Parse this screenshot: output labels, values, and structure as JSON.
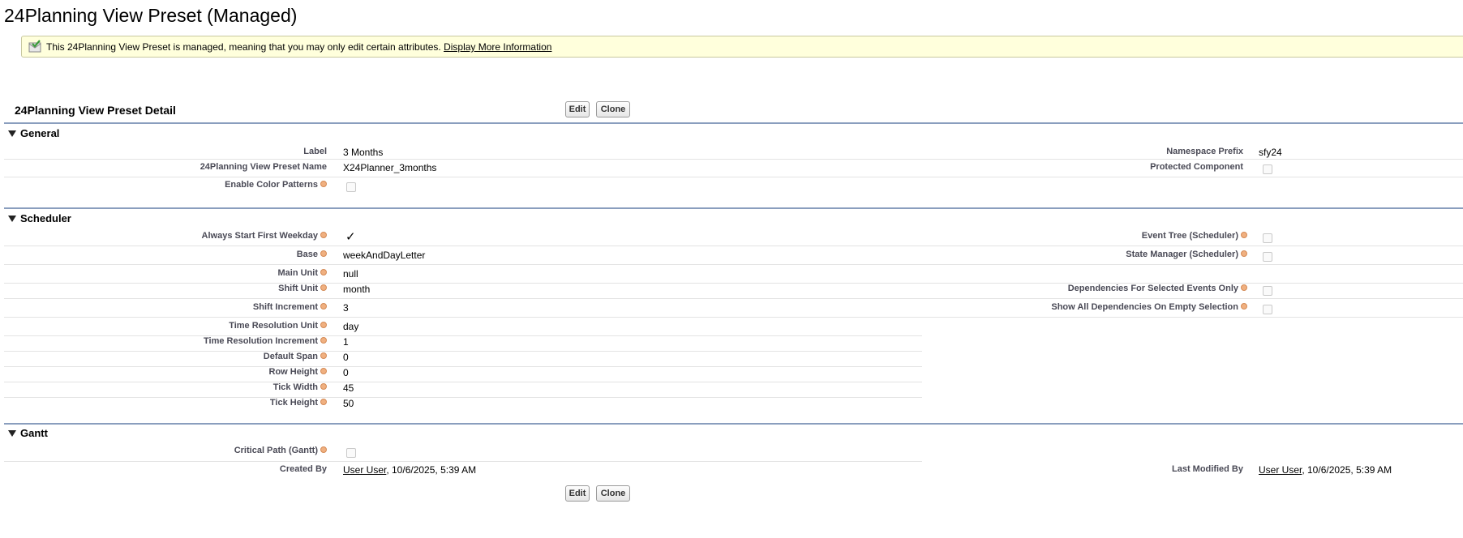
{
  "page_title": "24Planning View Preset (Managed)",
  "info": {
    "text": "This 24Planning View Preset is managed, meaning that you may only edit certain attributes.",
    "link": "Display More Information"
  },
  "detail_title": "24Planning View Preset Detail",
  "buttons": {
    "edit": "Edit",
    "clone": "Clone"
  },
  "general": {
    "title": "General",
    "label_label": "Label",
    "label_value": "3 Months",
    "name_label": "24Planning View Preset Name",
    "name_value": "X24Planner_3months",
    "color_patterns_label": "Enable Color Patterns",
    "namespace_label": "Namespace Prefix",
    "namespace_value": "sfy24",
    "protected_label": "Protected Component"
  },
  "scheduler": {
    "title": "Scheduler",
    "left": [
      {
        "label": "Always Start First Weekday",
        "value": "✓"
      },
      {
        "label": "Base",
        "value": "weekAndDayLetter"
      },
      {
        "label": "Main Unit",
        "value": "null"
      },
      {
        "label": "Shift Unit",
        "value": "month"
      },
      {
        "label": "Shift Increment",
        "value": "3"
      },
      {
        "label": "Time Resolution Unit",
        "value": "day"
      },
      {
        "label": "Time Resolution Increment",
        "value": "1"
      },
      {
        "label": "Default Span",
        "value": "0"
      },
      {
        "label": "Row Height",
        "value": "0"
      },
      {
        "label": "Tick Width",
        "value": "45"
      },
      {
        "label": "Tick Height",
        "value": "50"
      }
    ],
    "right": [
      {
        "label": "Event Tree (Scheduler)"
      },
      {
        "label": "State Manager (Scheduler)"
      },
      {
        "label": "Dependencies For Selected Events Only"
      },
      {
        "label": "Show All Dependencies On Empty Selection"
      }
    ]
  },
  "gantt": {
    "title": "Gantt",
    "critical_path_label": "Critical Path (Gantt)",
    "created_by_label": "Created By",
    "created_by_user": "User User",
    "created_by_date": ", 10/6/2025, 5:39 AM",
    "last_modified_label": "Last Modified By",
    "last_modified_user": "User User",
    "last_modified_date": ", 10/6/2025, 5:39 AM"
  }
}
